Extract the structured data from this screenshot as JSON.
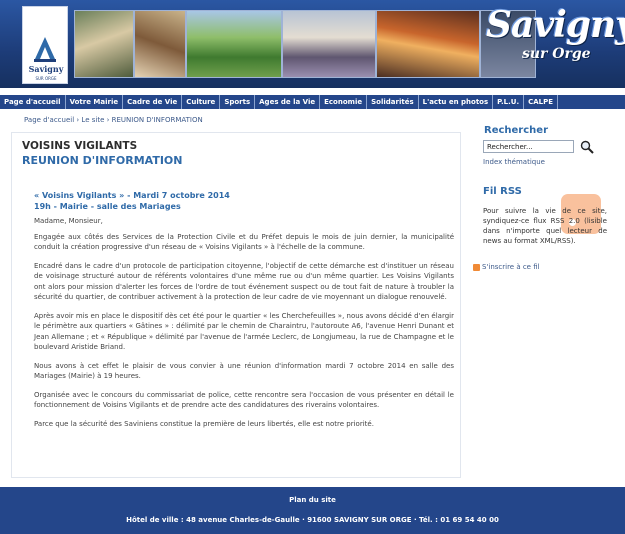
{
  "header": {
    "logo_text": "Savigny",
    "logo_sub": "SUR ORGE",
    "brand_name": "Savigny",
    "brand_sub": "sur Orge",
    "colors": {
      "banner": "#1f3f7a",
      "nav": "#24468a",
      "accent": "#2f6aa8"
    }
  },
  "nav": {
    "items": [
      {
        "label": "Page d'accueil"
      },
      {
        "label": "Votre Mairie"
      },
      {
        "label": "Cadre de Vie"
      },
      {
        "label": "Culture"
      },
      {
        "label": "Sports"
      },
      {
        "label": "Ages de la Vie"
      },
      {
        "label": "Economie"
      },
      {
        "label": "Solidarités"
      },
      {
        "label": "L'actu en photos"
      },
      {
        "label": "P.L.U."
      },
      {
        "label": "CALPE"
      }
    ]
  },
  "breadcrumb": {
    "home": "Page d'accueil",
    "sep1": " › ",
    "site": "Le site",
    "sep2": " › ",
    "current": "REUNION D'INFORMATION"
  },
  "article": {
    "kicker": "VOISINS VIGILANTS",
    "title": "REUNION D'INFORMATION",
    "lead_line1": "« Voisins Vigilants » - Mardi 7 octobre 2014",
    "lead_line2": "19h - Mairie - salle des Mariages",
    "greeting": "Madame, Monsieur,",
    "paragraphs": [
      "Engagée aux côtés des Services de la Protection Civile et du Préfet depuis le mois de juin dernier, la municipalité conduit la création progressive d'un réseau de « Voisins Vigilants » à l'échelle de la commune.",
      "Encadré dans le cadre d'un protocole de participation citoyenne, l'objectif de cette démarche est d'instituer un réseau de voisinage structuré autour de référents volontaires d'une même rue ou d'un même quartier. Les Voisins Vigilants ont alors pour mission d'alerter les forces de l'ordre de tout événement suspect ou de tout fait de nature à troubler la sécurité du quartier, de contribuer activement à la protection de leur cadre de vie moyennant un dialogue renouvelé.",
      "Après avoir mis en place le dispositif dès cet été pour le quartier « les Cherchefeuilles », nous avons décidé d'en élargir le périmètre aux quartiers « Gâtines » : délimité par le chemin de Charaintru, l'autoroute A6, l'avenue Henri Dunant et Jean Allemane ; et « République » délimité par l'avenue de l'armée Leclerc, de Longjumeau, la rue de Champagne et le boulevard Aristide Briand.",
      "Nous avons à cet effet le plaisir de vous convier à une réunion d'information mardi 7 octobre 2014 en salle des Mariages (Mairie) à 19 heures.",
      "Organisée avec le concours du commissariat de police, cette rencontre sera l'occasion de vous présenter en détail le fonctionnement de Voisins Vigilants et de prendre acte des candidatures des riverains volontaires.",
      "Parce que la sécurité des Saviniens constitue la première de leurs libertés, elle est notre priorité."
    ]
  },
  "sidebar": {
    "search_title": "Rechercher",
    "search_value": "Rechercher...",
    "index_link": "Index thématique",
    "rss_title": "Fil RSS",
    "rss_text": "Pour suivre la vie de ce site, syndiquez-ce flux RSS 2.0 (lisible dans n'importe quel lecteur de news au format XML/RSS).",
    "rss_link": "S'inscrire à ce fil"
  },
  "footer": {
    "plan_link": "Plan du site",
    "address": "Hôtel de ville : 48 avenue Charles-de-Gaulle · 91600 SAVIGNY SUR ORGE · Tél. : 01 69 54 40 00"
  }
}
